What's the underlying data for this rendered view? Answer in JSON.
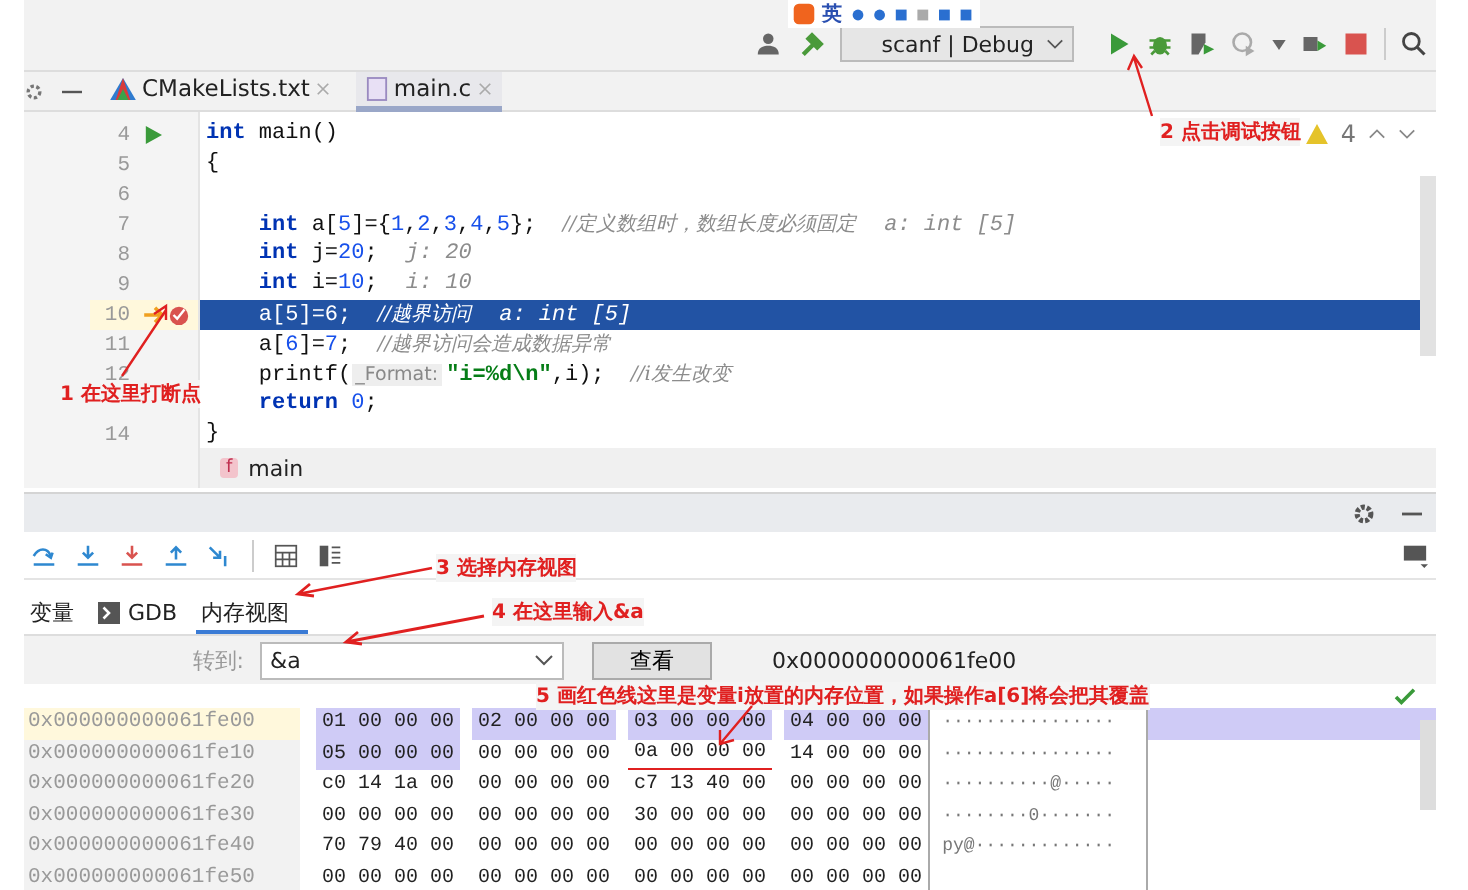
{
  "toolbar": {
    "ime_label": "英",
    "run_config": "scanf | Debug"
  },
  "tabs": [
    {
      "label": "CMakeLists.txt",
      "kind": "cmake",
      "selected": false
    },
    {
      "label": "main.c",
      "kind": "c",
      "selected": true
    }
  ],
  "editor": {
    "warning_count": "4",
    "lines": [
      {
        "number": "4",
        "run_marker": true,
        "breakpoint": false,
        "selected": false,
        "segments": [
          {
            "kind": "keyword",
            "text": "int"
          },
          {
            "kind": "plain",
            "text": " main()"
          }
        ]
      },
      {
        "number": "5",
        "run_marker": false,
        "breakpoint": false,
        "selected": false,
        "segments": [
          {
            "kind": "plain",
            "text": "{"
          }
        ]
      },
      {
        "number": "6",
        "run_marker": false,
        "breakpoint": false,
        "selected": false
      },
      {
        "number": "7",
        "run_marker": false,
        "breakpoint": false,
        "selected": false,
        "segments": [
          {
            "kind": "keyword",
            "text": "    int"
          },
          {
            "kind": "plain",
            "text": " a["
          },
          {
            "kind": "number",
            "text": "5"
          },
          {
            "kind": "plain",
            "text": "]={"
          },
          {
            "kind": "number",
            "text": "1"
          },
          {
            "kind": "plain",
            "text": ","
          },
          {
            "kind": "number",
            "text": "2"
          },
          {
            "kind": "plain",
            "text": ","
          },
          {
            "kind": "number",
            "text": "3"
          },
          {
            "kind": "plain",
            "text": ","
          },
          {
            "kind": "number",
            "text": "4"
          },
          {
            "kind": "plain",
            "text": ","
          },
          {
            "kind": "number",
            "text": "5"
          },
          {
            "kind": "plain",
            "text": "};  "
          },
          {
            "kind": "comment",
            "text": "//定义数组时，数组长度必须固定"
          },
          {
            "kind": "hint",
            "text": "a: int [5]"
          }
        ]
      },
      {
        "number": "8",
        "run_marker": false,
        "breakpoint": false,
        "selected": false,
        "segments": [
          {
            "kind": "keyword",
            "text": "    int"
          },
          {
            "kind": "plain",
            "text": " j="
          },
          {
            "kind": "number",
            "text": "20"
          },
          {
            "kind": "plain",
            "text": ";"
          },
          {
            "kind": "hint",
            "text": "j: 20"
          }
        ]
      },
      {
        "number": "9",
        "run_marker": false,
        "breakpoint": false,
        "selected": false,
        "segments": [
          {
            "kind": "keyword",
            "text": "    int"
          },
          {
            "kind": "plain",
            "text": " i="
          },
          {
            "kind": "number",
            "text": "10"
          },
          {
            "kind": "plain",
            "text": ";"
          },
          {
            "kind": "hint",
            "text": "i: 10"
          }
        ]
      },
      {
        "number": "10",
        "run_marker": false,
        "breakpoint": true,
        "selected": true,
        "segments": [
          {
            "kind": "plain",
            "text": "    a["
          },
          {
            "kind": "number",
            "text": "5"
          },
          {
            "kind": "plain",
            "text": "]="
          },
          {
            "kind": "number",
            "text": "6"
          },
          {
            "kind": "plain",
            "text": ";  "
          },
          {
            "kind": "comment",
            "text": "//越界访问"
          },
          {
            "kind": "hint",
            "text": "a: int [5]"
          }
        ]
      },
      {
        "number": "11",
        "run_marker": false,
        "breakpoint": false,
        "selected": false,
        "segments": [
          {
            "kind": "plain",
            "text": "    a["
          },
          {
            "kind": "number",
            "text": "6"
          },
          {
            "kind": "plain",
            "text": "]="
          },
          {
            "kind": "number",
            "text": "7"
          },
          {
            "kind": "plain",
            "text": ";  "
          },
          {
            "kind": "comment",
            "text": "//越界访问会造成数据异常"
          }
        ]
      },
      {
        "number": "12",
        "run_marker": false,
        "breakpoint": false,
        "selected": false,
        "segments": [
          {
            "kind": "plain",
            "text": "    printf("
          },
          {
            "kind": "param",
            "text": "_Format:"
          },
          {
            "kind": "string",
            "text": "\"i=%d\\n\""
          },
          {
            "kind": "plain",
            "text": ",i);  "
          },
          {
            "kind": "comment",
            "text": "//i发生改变"
          }
        ]
      },
      {
        "run_marker": false,
        "breakpoint": false,
        "selected": false,
        "segments": [
          {
            "kind": "keyword",
            "text": "    return"
          },
          {
            "kind": "number",
            "text": " 0"
          },
          {
            "kind": "plain",
            "text": ";"
          }
        ]
      },
      {
        "number": "14",
        "run_marker": false,
        "breakpoint": false,
        "selected": false,
        "segments": [
          {
            "kind": "plain",
            "text": "}"
          }
        ]
      }
    ],
    "breadcrumb": {
      "badge": "f",
      "label": "main"
    }
  },
  "debug_panel": {
    "tabs": [
      {
        "label": "变量",
        "kind": "plain",
        "selected": false
      },
      {
        "label": "GDB",
        "kind": "console",
        "selected": false
      },
      {
        "label": "内存视图",
        "kind": "plain",
        "selected": true
      }
    ],
    "goto_label": "转到:",
    "goto_value": "&a",
    "view_button": "查看",
    "address": "0x000000000061fe00",
    "rows": [
      {
        "address": "0x000000000061fe00",
        "selected": true,
        "ascii": "················",
        "groups": [
          {
            "text": "01 00 00 00",
            "selected": true,
            "underlined": false
          },
          {
            "text": "02 00 00 00",
            "selected": true,
            "underlined": false
          },
          {
            "text": "03 00 00 00",
            "selected": true,
            "underlined": false
          },
          {
            "text": "04 00 00 00",
            "selected": true,
            "underlined": false
          }
        ]
      },
      {
        "address": "0x000000000061fe10",
        "selected": false,
        "ascii": "················",
        "groups": [
          {
            "text": "05 00 00 00",
            "selected": true,
            "underlined": false
          },
          {
            "text": "00 00 00 00",
            "selected": false,
            "underlined": false
          },
          {
            "text": "0a 00 00 00",
            "selected": false,
            "underlined": true
          },
          {
            "text": "14 00 00 00",
            "selected": false,
            "underlined": false
          }
        ]
      },
      {
        "address": "0x000000000061fe20",
        "selected": false,
        "ascii": "··········@·····",
        "groups": [
          {
            "text": "c0 14 1a 00",
            "selected": false,
            "underlined": false
          },
          {
            "text": "00 00 00 00",
            "selected": false,
            "underlined": false
          },
          {
            "text": "c7 13 40 00",
            "selected": false,
            "underlined": false
          },
          {
            "text": "00 00 00 00",
            "selected": false,
            "underlined": false
          }
        ]
      },
      {
        "address": "0x000000000061fe30",
        "selected": false,
        "ascii": "········0·······",
        "groups": [
          {
            "text": "00 00 00 00",
            "selected": false,
            "underlined": false
          },
          {
            "text": "00 00 00 00",
            "selected": false,
            "underlined": false
          },
          {
            "text": "30 00 00 00",
            "selected": false,
            "underlined": false
          },
          {
            "text": "00 00 00 00",
            "selected": false,
            "underlined": false
          }
        ]
      },
      {
        "address": "0x000000000061fe40",
        "selected": false,
        "ascii": "py@·············",
        "groups": [
          {
            "text": "70 79 40 00",
            "selected": false,
            "underlined": false
          },
          {
            "text": "00 00 00 00",
            "selected": false,
            "underlined": false
          },
          {
            "text": "00 00 00 00",
            "selected": false,
            "underlined": false
          },
          {
            "text": "00 00 00 00",
            "selected": false,
            "underlined": false
          }
        ]
      },
      {
        "address": "0x000000000061fe50",
        "selected": false,
        "groups": [
          {
            "text": "00 00 00 00",
            "selected": false,
            "underlined": false
          },
          {
            "text": "00 00 00 00",
            "selected": false,
            "underlined": false
          },
          {
            "text": "00 00 00 00",
            "selected": false,
            "underlined": false
          },
          {
            "text": "00 00 00 00",
            "selected": false,
            "underlined": false
          }
        ]
      }
    ]
  },
  "annotations": [
    "1 在这里打断点",
    "2 点击调试按钮",
    "3 选择内存视图",
    "4 在这里输入&a",
    "5 画红色线这里是变量i放置的内存位置，如果操作a[6]将会把其覆盖"
  ]
}
